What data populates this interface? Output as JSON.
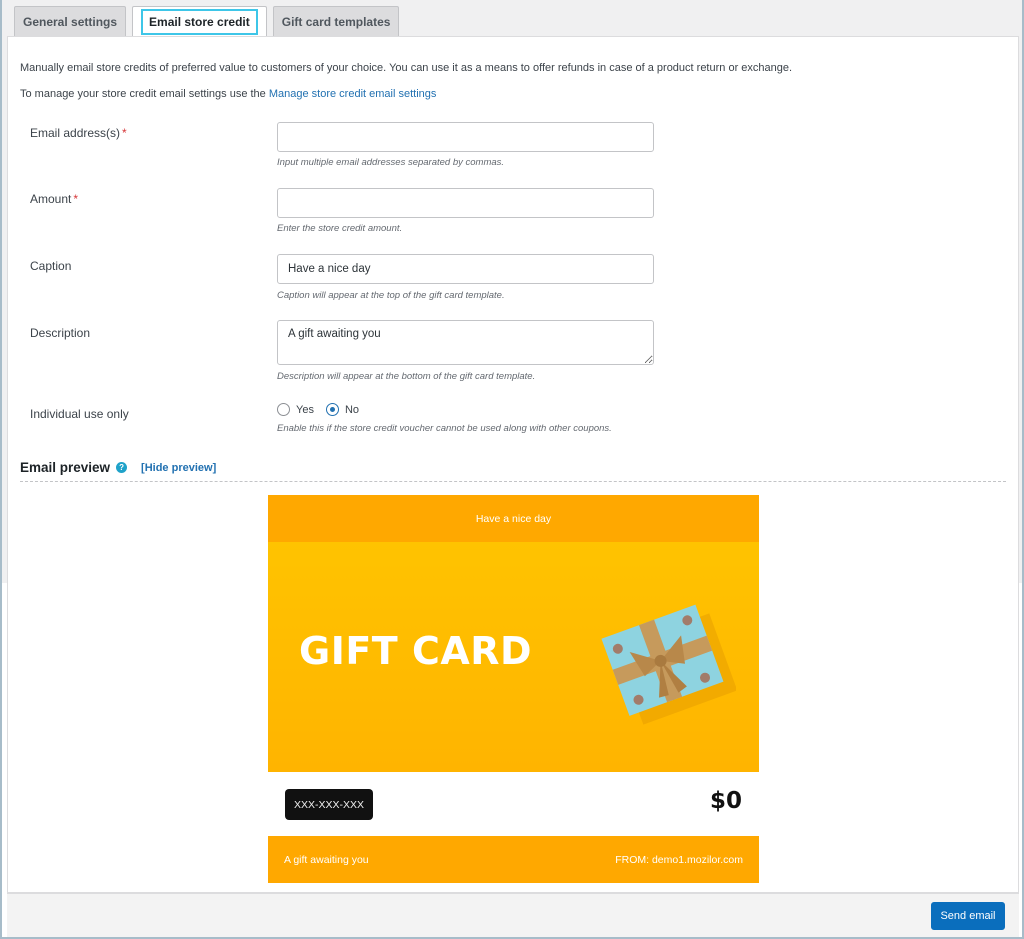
{
  "tabs": [
    {
      "label": "General settings",
      "active": false
    },
    {
      "label": "Email store credit",
      "active": true
    },
    {
      "label": "Gift card templates",
      "active": false
    }
  ],
  "intro": {
    "text": "Manually email store credits of preferred value to customers of your choice. You can use it as a means to offer refunds in case of a product return or exchange.",
    "manage_prefix": "To manage your store credit email settings use the ",
    "manage_link": "Manage store credit email settings"
  },
  "form": {
    "email": {
      "label": "Email address(s)",
      "required": "*",
      "value": "",
      "help": "Input multiple email addresses separated by commas."
    },
    "amount": {
      "label": "Amount",
      "required": "*",
      "value": "",
      "help": "Enter the store credit amount."
    },
    "caption": {
      "label": "Caption",
      "value": "Have a nice day",
      "help": "Caption will appear at the top of the gift card template."
    },
    "description": {
      "label": "Description",
      "value": "A gift awaiting you",
      "help": "Description will appear at the bottom of the gift card template."
    },
    "individual_use": {
      "label": "Individual use only",
      "options": [
        {
          "label": "Yes",
          "checked": false
        },
        {
          "label": "No",
          "checked": true
        }
      ],
      "help": "Enable this if the store credit voucher cannot be used along with other coupons."
    }
  },
  "preview": {
    "title": "Email preview",
    "help_icon": "?",
    "hide_link": "[Hide preview]",
    "card": {
      "caption": "Have a nice day",
      "hero_title": "GIFT CARD",
      "image": "gift-box",
      "code": "XXX-XXX-XXX",
      "amount": "$0",
      "description": "A gift awaiting you",
      "from": "FROM: demo1.mozilor.com",
      "accent_color": "#ffa800"
    }
  },
  "footer": {
    "send_label": "Send email",
    "button_color": "#0a6ebd"
  }
}
